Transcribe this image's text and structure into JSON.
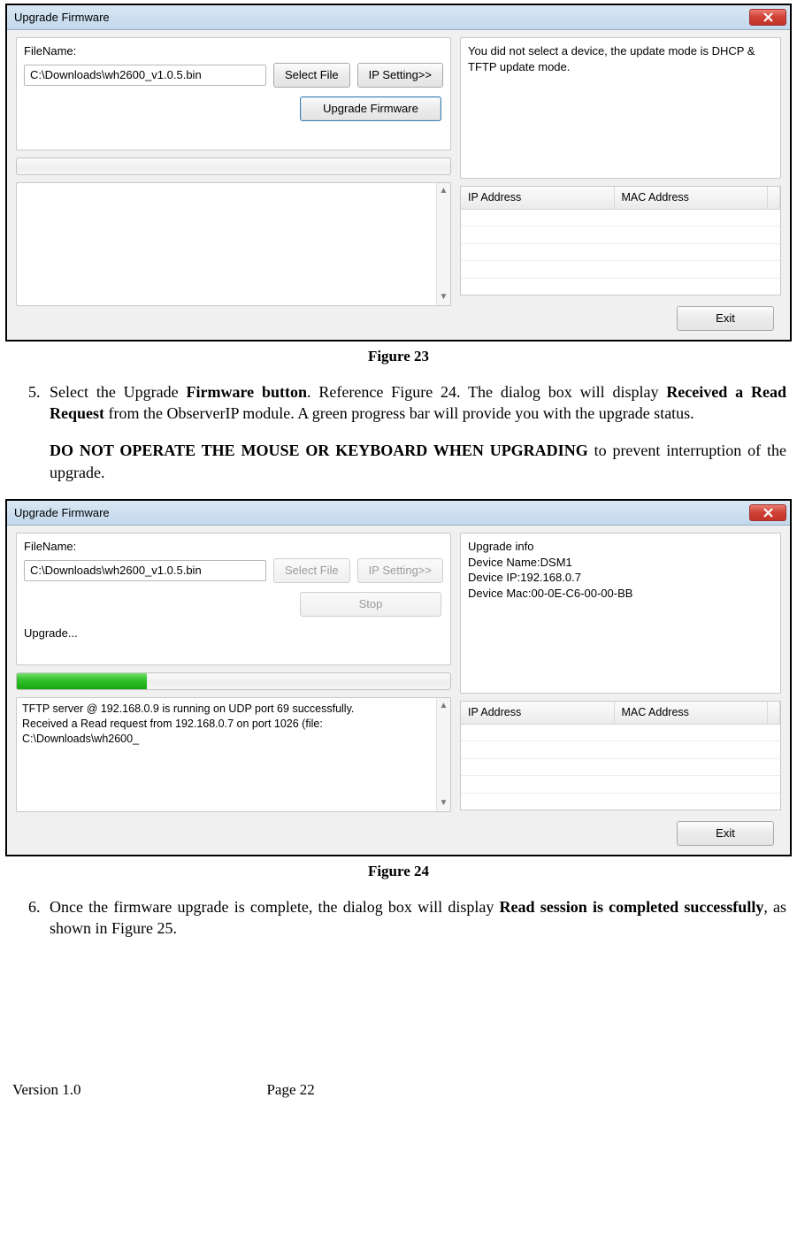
{
  "dialog1": {
    "title": "Upgrade Firmware",
    "filename_label": "FileName:",
    "filename_value": "C:\\Downloads\\wh2600_v1.0.5.bin",
    "select_file_btn": "Select File",
    "ip_setting_btn": "IP Setting>>",
    "upgrade_firmware_btn": "Upgrade Firmware",
    "note": "You did not select a device, the update mode is DHCP & TFTP update mode.",
    "table": {
      "col_ip": "IP Address",
      "col_mac": "MAC Address"
    },
    "exit_btn": "Exit"
  },
  "caption1": "Figure 23",
  "step5_num": "5.",
  "step5_a": "Select the Upgrade ",
  "step5_b": "Firmware button",
  "step5_c": ". Reference Figure 24.   The dialog box will display ",
  "step5_d": "Received a Read Request",
  "step5_e": " from the ObserverIP module. A green progress bar will provide you with the upgrade status.",
  "step5_f": "DO NOT OPERATE THE MOUSE OR KEYBOARD WHEN UPGRADING",
  "step5_g": " to prevent interruption of the upgrade.",
  "dialog2": {
    "title": "Upgrade Firmware",
    "filename_label": "FileName:",
    "filename_value": "C:\\Downloads\\wh2600_v1.0.5.bin",
    "select_file_btn": "Select File",
    "ip_setting_btn": "IP Setting>>",
    "stop_btn": "Stop",
    "status_label": "Upgrade...",
    "progress_percent": 30,
    "info_label": "Upgrade info",
    "info_name": "Device Name:DSM1",
    "info_ip": "Device IP:192.168.0.7",
    "info_mac": "Device Mac:00-0E-C6-00-00-BB",
    "log_line1": "TFTP server @ 192.168.0.9 is running on UDP port 69 successfully.",
    "log_line2": "Received a Read request from 192.168.0.7 on port 1026 (file: C:\\Downloads\\wh2600_",
    "table": {
      "col_ip": "IP Address",
      "col_mac": "MAC Address"
    },
    "exit_btn": "Exit"
  },
  "caption2": "Figure 24",
  "step6_num": "6.",
  "step6_a": "Once the firmware upgrade is complete, the dialog box will display ",
  "step6_b": "Read session is completed successfully",
  "step6_c": ", as shown in Figure 25.",
  "footer": {
    "version": "Version 1.0",
    "page": "Page 22"
  }
}
